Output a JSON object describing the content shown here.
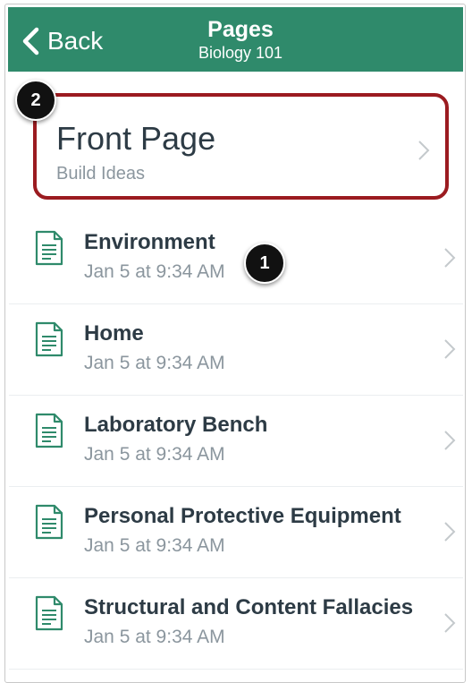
{
  "header": {
    "back_label": "Back",
    "title": "Pages",
    "subtitle": "Biology 101",
    "color": "#2f8a6b"
  },
  "front_page": {
    "title": "Front Page",
    "subtitle": "Build Ideas",
    "highlight_color": "#9b1b20"
  },
  "badges": [
    "1",
    "2"
  ],
  "pages": [
    {
      "name": "Environment",
      "date": "Jan 5 at 9:34 AM",
      "icon": "document-icon"
    },
    {
      "name": "Home",
      "date": "Jan 5 at 9:34 AM",
      "icon": "document-icon"
    },
    {
      "name": "Laboratory Bench",
      "date": "Jan 5 at 9:34 AM",
      "icon": "document-icon"
    },
    {
      "name": "Personal Protective Equipment",
      "date": "Jan 5 at 9:34 AM",
      "icon": "document-icon"
    },
    {
      "name": "Structural and Content Fallacies",
      "date": "Jan 5 at 9:34 AM",
      "icon": "document-icon"
    }
  ]
}
